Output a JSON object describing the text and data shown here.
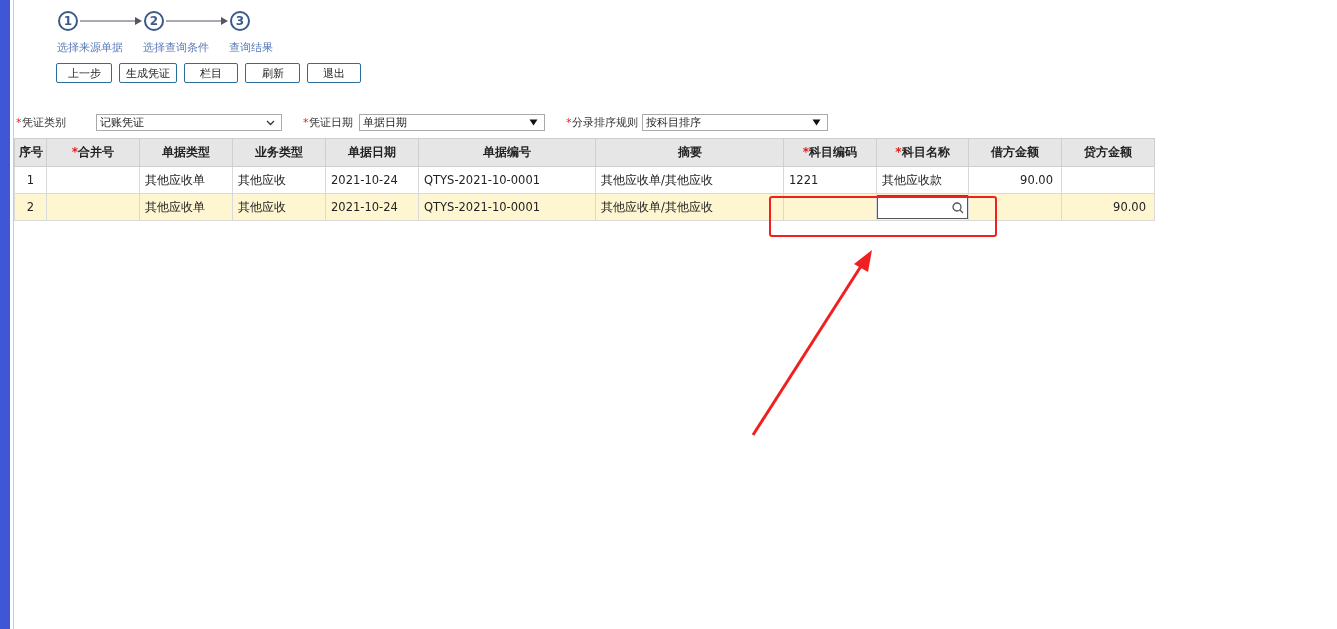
{
  "steps": [
    {
      "number": "1",
      "label": "选择来源单据"
    },
    {
      "number": "2",
      "label": "选择查询条件"
    },
    {
      "number": "3",
      "label": "查询结果"
    }
  ],
  "buttons": [
    "上一步",
    "生成凭证",
    "栏目",
    "刷新",
    "退出"
  ],
  "filters": [
    {
      "mark": "*",
      "label": "凭证类别",
      "value": "记账凭证",
      "kind": "chevron"
    },
    {
      "mark": "*",
      "label": "凭证日期",
      "value": "单据日期",
      "kind": "triangle"
    },
    {
      "mark": "*",
      "label": "分录排序规则",
      "value": "按科目排序",
      "kind": "triangle"
    }
  ],
  "table": {
    "columns": [
      {
        "label": "序号",
        "kind": "index"
      },
      {
        "label": "合并号",
        "mark": "*",
        "kind": "text"
      },
      {
        "label": "单据类型",
        "kind": "text"
      },
      {
        "label": "业务类型",
        "kind": "text"
      },
      {
        "label": "单据日期",
        "kind": "text"
      },
      {
        "label": "单据编号",
        "kind": "text"
      },
      {
        "label": "摘要",
        "kind": "text"
      },
      {
        "label": "科目编码",
        "mark": "*",
        "kind": "text"
      },
      {
        "label": "科目名称",
        "mark": "*",
        "kind": "text"
      },
      {
        "label": "借方金额",
        "kind": "amount"
      },
      {
        "label": "贷方金额",
        "kind": "amount"
      }
    ],
    "rows": [
      {
        "selected": false,
        "cells": [
          {
            "kind": "text",
            "text": "1"
          },
          {
            "kind": "empty"
          },
          {
            "kind": "text",
            "text": "其他应收单"
          },
          {
            "kind": "text",
            "text": "其他应收"
          },
          {
            "kind": "text",
            "text": "2021-10-24"
          },
          {
            "kind": "text",
            "text": "QTYS-2021-10-0001"
          },
          {
            "kind": "text",
            "text": "其他应收单/其他应收"
          },
          {
            "kind": "text",
            "text": "1221"
          },
          {
            "kind": "text",
            "text": "其他应收款"
          },
          {
            "kind": "text",
            "text": "90.00"
          },
          {
            "kind": "empty"
          }
        ]
      },
      {
        "selected": true,
        "cells": [
          {
            "kind": "text",
            "text": "2"
          },
          {
            "kind": "empty"
          },
          {
            "kind": "text",
            "text": "其他应收单"
          },
          {
            "kind": "text",
            "text": "其他应收"
          },
          {
            "kind": "text",
            "text": "2021-10-24"
          },
          {
            "kind": "text",
            "text": "QTYS-2021-10-0001"
          },
          {
            "kind": "text",
            "text": "其他应收单/其他应收"
          },
          {
            "kind": "empty"
          },
          {
            "kind": "input"
          },
          {
            "kind": "empty"
          },
          {
            "kind": "text",
            "text": "90.00"
          }
        ]
      }
    ]
  }
}
